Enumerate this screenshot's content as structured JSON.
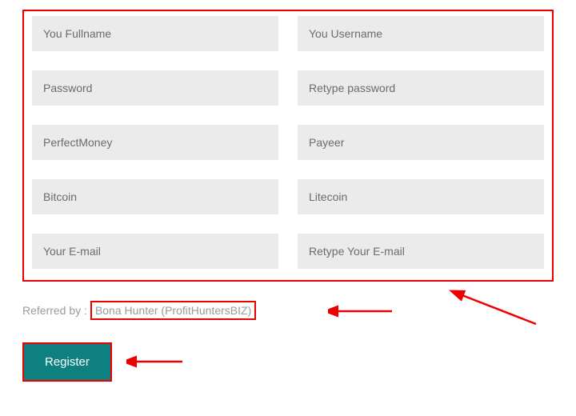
{
  "form": {
    "fullname_placeholder": "You Fullname",
    "username_placeholder": "You Username",
    "password_placeholder": "Password",
    "retype_password_placeholder": "Retype password",
    "perfectmoney_placeholder": "PerfectMoney",
    "payeer_placeholder": "Payeer",
    "bitcoin_placeholder": "Bitcoin",
    "litecoin_placeholder": "Litecoin",
    "email_placeholder": "Your E-mail",
    "retype_email_placeholder": "Retype Your E-mail"
  },
  "referred": {
    "label": "Referred by : ",
    "value": "Bona Hunter (ProfitHuntersBIZ)"
  },
  "register_label": "Register"
}
